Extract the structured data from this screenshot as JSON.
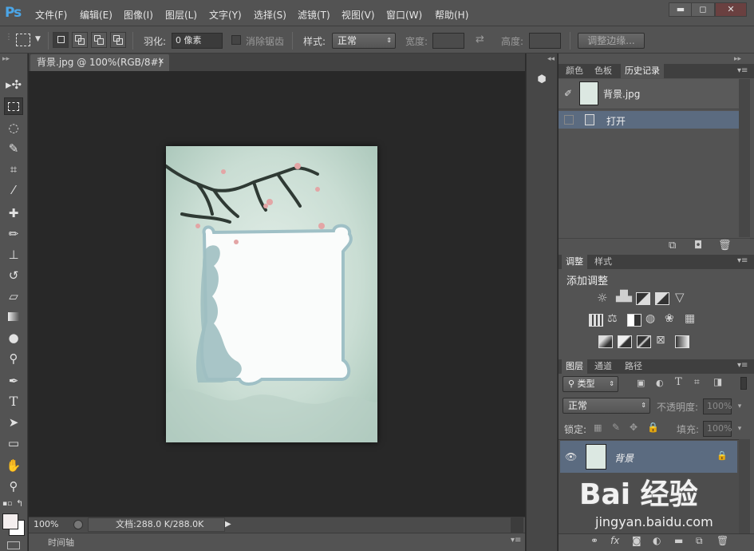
{
  "app": {
    "logo": "Ps"
  },
  "menu": [
    "文件(F)",
    "编辑(E)",
    "图像(I)",
    "图层(L)",
    "文字(Y)",
    "选择(S)",
    "滤镜(T)",
    "视图(V)",
    "窗口(W)",
    "帮助(H)"
  ],
  "window_controls": {
    "minimize": "▬",
    "maximize": "◻",
    "close": "✕"
  },
  "options": {
    "feather_label": "羽化:",
    "feather_value": "0 像素",
    "antialias_label": "消除锯齿",
    "style_label": "样式:",
    "style_value": "正常",
    "width_label": "宽度:",
    "height_label": "高度:",
    "refine_edge": "调整边缘..."
  },
  "document": {
    "tab_title": "背景.jpg @ 100%(RGB/8#)",
    "zoom": "100%",
    "doc_info": "文档:288.0 K/288.0K",
    "timeline_label": "时间轴"
  },
  "panels": {
    "top_tabs": [
      "颜色",
      "色板",
      "历史记录"
    ],
    "history": {
      "snapshot": "背景.jpg",
      "items": [
        "打开"
      ]
    },
    "adjust_tabs": [
      "调整",
      "样式"
    ],
    "adjust_title": "添加调整",
    "layers_tabs": [
      "图层",
      "通道",
      "路径"
    ],
    "layers": {
      "filter_kind": "类型",
      "blend_mode": "正常",
      "opacity_label": "不透明度:",
      "opacity_value": "100%",
      "lock_label": "锁定:",
      "fill_label": "填充:",
      "fill_value": "100%",
      "layer_name": "背景"
    }
  },
  "watermark": {
    "text": "Bai 经验",
    "url": "jingyan.baidu.com"
  },
  "colors": {
    "accent": "#4ba6e8",
    "selected_row": "#5b6b80",
    "canvas_bg": "#282828"
  }
}
